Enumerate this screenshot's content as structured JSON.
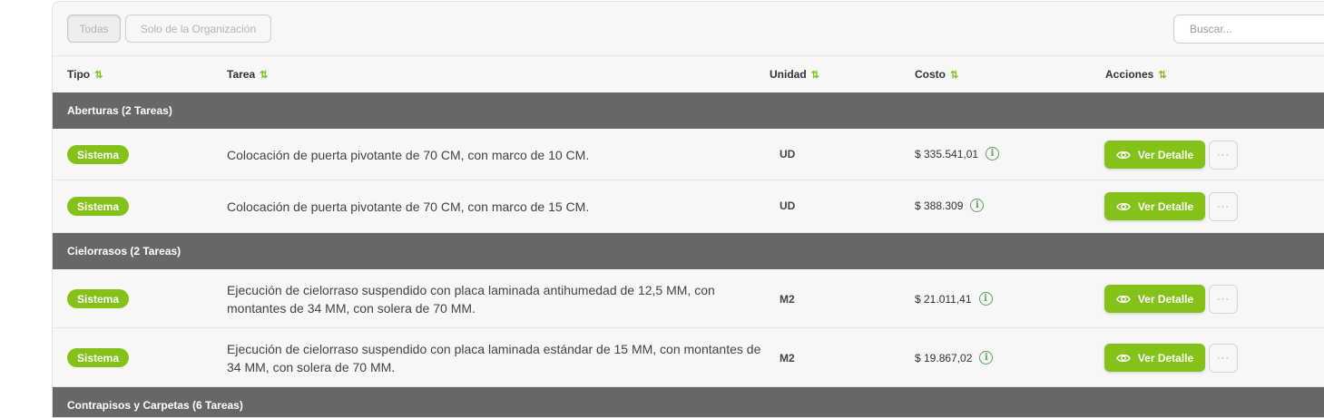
{
  "filters": {
    "all_label": "Todas",
    "org_label": "Solo de la Organización"
  },
  "search": {
    "placeholder": "Buscar..."
  },
  "columns": {
    "tipo": "Tipo",
    "tarea": "Tarea",
    "unidad": "Unidad",
    "costo": "Costo",
    "acciones": "Acciones"
  },
  "sort_icon": "⇅",
  "groups": [
    {
      "title": "Aberturas (2 Tareas)",
      "rows": [
        {
          "tipo": "Sistema",
          "tarea": "Colocación de puerta pivotante de 70 CM, con marco de 10 CM.",
          "unidad": "UD",
          "costo": "$ 335.541,01"
        },
        {
          "tipo": "Sistema",
          "tarea": "Colocación de puerta pivotante de 70 CM, con marco de 15 CM.",
          "unidad": "UD",
          "costo": "$ 388.309"
        }
      ]
    },
    {
      "title": "Cielorrasos (2 Tareas)",
      "rows": [
        {
          "tipo": "Sistema",
          "tarea": "Ejecución de cielorraso suspendido con placa laminada antihumedad de 12,5 MM, con montantes de 34 MM, con solera de 70 MM.",
          "unidad": "M2",
          "costo": "$ 21.011,41"
        },
        {
          "tipo": "Sistema",
          "tarea": "Ejecución de cielorraso suspendido con placa laminada estándar de 15 MM, con montantes de 34 MM, con solera de 70 MM.",
          "unidad": "M2",
          "costo": "$ 19.867,02"
        }
      ]
    },
    {
      "title": "Contrapisos y Carpetas (6 Tareas)",
      "rows": []
    }
  ],
  "actions": {
    "detail_label": "Ver Detalle",
    "info_glyph": "i",
    "more_glyph": "···"
  },
  "colors": {
    "accent": "#84c21a",
    "group_bg": "#676767",
    "info": "#5fa05f"
  }
}
